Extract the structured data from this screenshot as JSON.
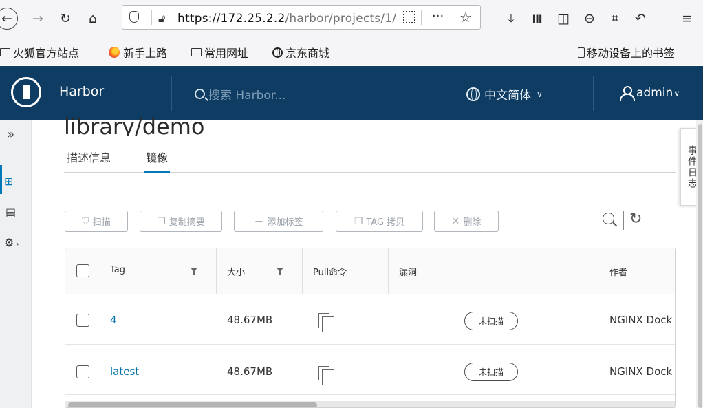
{
  "browser": {
    "url_host": "https://172.25.2.2",
    "url_path": "/harbor/projects/1/"
  },
  "bookmarks": [
    {
      "label": "火狐官方站点",
      "icon": "folder-icon"
    },
    {
      "label": "新手上路",
      "icon": "firefox-icon"
    },
    {
      "label": "常用网址",
      "icon": "folder-icon"
    },
    {
      "label": "京东商城",
      "icon": "globe-icon"
    }
  ],
  "mobile_bookmarks": "移动设备上的书签",
  "header": {
    "app_name": "Harbor",
    "search_placeholder": "搜索 Harbor...",
    "language": "中文简体",
    "user": "admin"
  },
  "page": {
    "title": "library/demo",
    "tabs": [
      {
        "label": "描述信息",
        "active": false
      },
      {
        "label": "镜像",
        "active": true
      }
    ]
  },
  "actions": {
    "scan": "扫描",
    "copy_digest": "复制摘要",
    "add_label": "添加标签",
    "copy_tag": "TAG 拷贝",
    "delete": "删除"
  },
  "table": {
    "columns": [
      "Tag",
      "大小",
      "Pull命令",
      "漏洞",
      "作者"
    ],
    "rows": [
      {
        "tag": "4",
        "size": "48.67MB",
        "vuln": "未扫描",
        "author": "NGINX Dock"
      },
      {
        "tag": "latest",
        "size": "48.67MB",
        "vuln": "未扫描",
        "author": "NGINX Dock"
      }
    ]
  },
  "event_log": "事件日志"
}
